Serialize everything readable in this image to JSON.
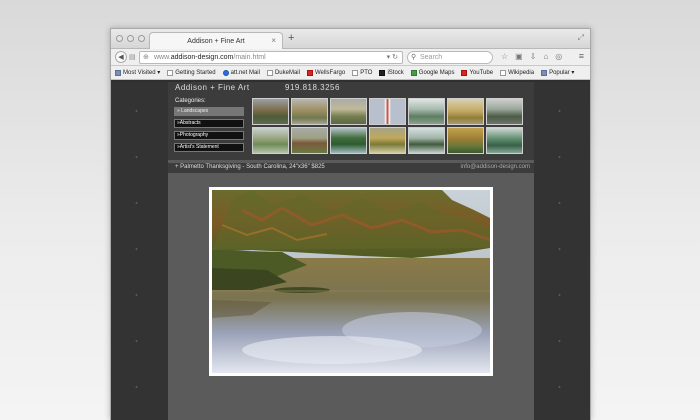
{
  "browser": {
    "tab_title": "Addison + Fine Art",
    "tab_close": "×",
    "new_tab": "+",
    "url_prefix": "www.",
    "url_host": "addison-design.com",
    "url_path": "/main.html",
    "search_placeholder": "Search",
    "bookmarks": [
      {
        "label": "Most Visited ▾",
        "icon": "folder-icon"
      },
      {
        "label": "Getting Started",
        "icon": "page-icon"
      },
      {
        "label": "att.net Mail",
        "icon": "att-icon"
      },
      {
        "label": "DukeMail",
        "icon": "page-icon"
      },
      {
        "label": "WellsFargo",
        "icon": "wellsfargo-icon"
      },
      {
        "label": "PTO",
        "icon": "page-icon"
      },
      {
        "label": "iStock",
        "icon": "istock-icon"
      },
      {
        "label": "Google Maps",
        "icon": "google-maps-icon"
      },
      {
        "label": "YouTube",
        "icon": "youtube-icon"
      },
      {
        "label": "Wikipedia",
        "icon": "page-icon"
      },
      {
        "label": "Popular ▾",
        "icon": "folder-icon"
      }
    ]
  },
  "site": {
    "title": "Addison + Fine Art",
    "phone": "919.818.3256",
    "categories_label": "Categories:",
    "categories": [
      {
        "label": "»  Landscapes"
      },
      {
        "label": "»Abstracts"
      },
      {
        "label": "»Photography"
      },
      {
        "label": "»Artist's Statement"
      }
    ],
    "caption": "+  Palmetto Thanksgiving - South Carolina, 24\"x36\" $825",
    "email": "info@addison-design.com"
  },
  "colors": {
    "page_bg": "#333333",
    "content_bg": "#5b5b5b",
    "header_bg": "#3c3c3c"
  }
}
